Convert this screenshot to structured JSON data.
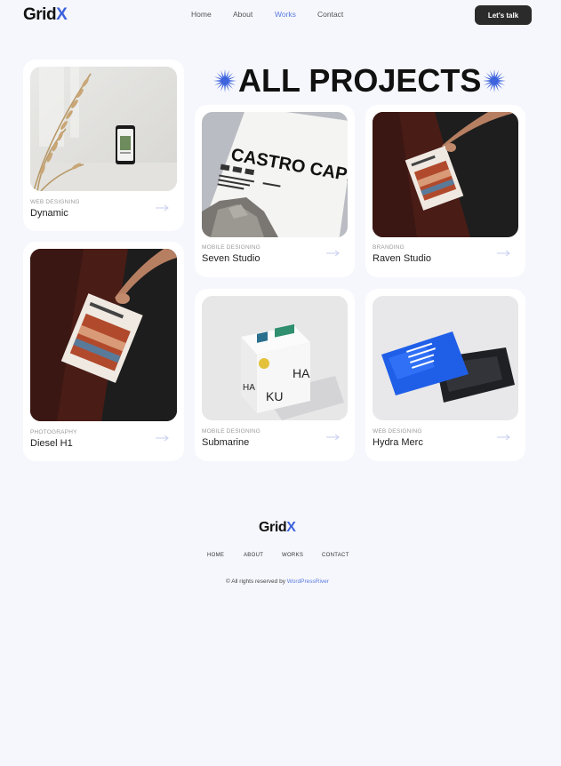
{
  "brand": {
    "name_main": "Grid",
    "name_accent": "X",
    "accent_color": "#3d63dd"
  },
  "nav": {
    "items": [
      "Home",
      "About",
      "Works",
      "Contact"
    ],
    "active": "Works"
  },
  "cta": {
    "label": "Let's talk"
  },
  "page_title": "ALL PROJECTS",
  "projects": [
    {
      "category": "WEB DESIGNING",
      "title": "Dynamic"
    },
    {
      "category": "PHOTOGRAPHY",
      "title": "Diesel H1"
    },
    {
      "category": "MOBILE DESIGNING",
      "title": "Seven Studio",
      "image_text": "CASTRO CAPIT"
    },
    {
      "category": "BRANDING",
      "title": "Raven Studio"
    },
    {
      "category": "MOBILE DESIGNING",
      "title": "Submarine"
    },
    {
      "category": "WEB DESIGNING",
      "title": "Hydra Merc"
    }
  ],
  "footer": {
    "nav": [
      "HOME",
      "ABOUT",
      "WORKS",
      "CONTACT"
    ],
    "copyright_prefix": "© All rights reserved by ",
    "copyright_brand": "WordPressRiver"
  }
}
